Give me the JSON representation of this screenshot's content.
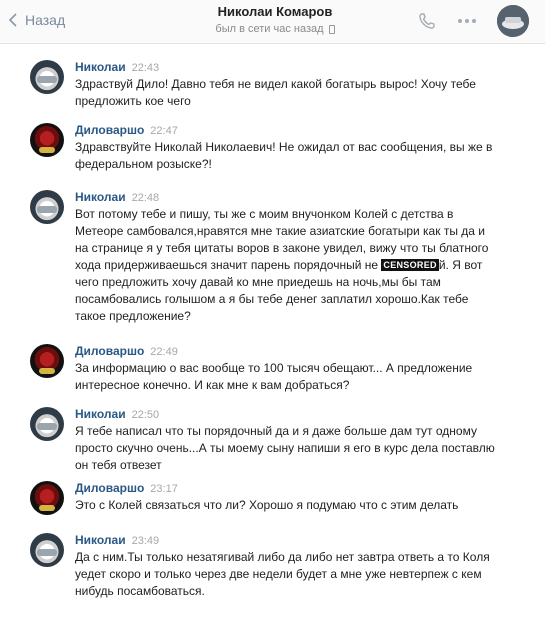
{
  "header": {
    "back_label": "Назад",
    "title": "Николаи Комаров",
    "status": "был в сети час назад"
  },
  "messages": [
    {
      "avatar": "car-avatar",
      "name": "Николаи",
      "time": "22:43",
      "text": "Здраствуй Дило! Давно тебя не видел какой богатырь вырос! Хочу тебе\nпредложить кое чего"
    },
    {
      "avatar": "fighter-avatar",
      "name": "Диловаршо",
      "time": "22:47",
      "text": "Здравствуйте Николай Николаевич! Не ожидал от вас сообщения, вы же в\nфедеральном розыске?!"
    },
    {
      "avatar": "car-avatar",
      "name": "Николаи",
      "time": "22:48",
      "text_before": "Вот потому тебе и пишу, ты же с моим внучонком Колей с детства в\nМетеоре самбовался,нравятся мне такие азиатские богатыри как ты да и\nна странице я у тебя цитаты воров в законе увидел, вижу что ты блатного\nхода придерживаешься значит парень порядочный не ",
      "censor": "CENSORED",
      "text_after": "й. Я вот\nчего предложить хочу давай ко мне приедешь на ночь,мы бы там\nпосамбовались голышом а я бы тебе денег заплатил хорошо.Как тебе\nтакое предложение?"
    },
    {
      "avatar": "fighter-avatar",
      "name": "Диловаршо",
      "time": "22:49",
      "text": "За информацию о вас вообще то 100 тысяч обещают... А предложение\nинтересное конечно. И как мне к вам добраться?"
    },
    {
      "avatar": "car-avatar",
      "name": "Николаи",
      "time": "22:50",
      "text": "Я тебе написал что ты порядочный да и я даже больше дам тут одному\nпросто скучно очень...А ты моему сыну напиши я его в курс дела поставлю\nон тебя отвезет"
    },
    {
      "avatar": "fighter-avatar",
      "name": "Диловаршо",
      "time": "23:17",
      "text": "Это с Колей связаться что ли? Хорошо я подумаю что с этим делать"
    },
    {
      "avatar": "car-avatar",
      "name": "Николаи",
      "time": "23:49",
      "text": "Да с ним.Ты только незатягивай либо да либо нет завтра ответь а то Коля\nуедет скоро и только через две недели будет а мне уже невтерпеж с кем\nнибудь посамбоваться."
    }
  ]
}
